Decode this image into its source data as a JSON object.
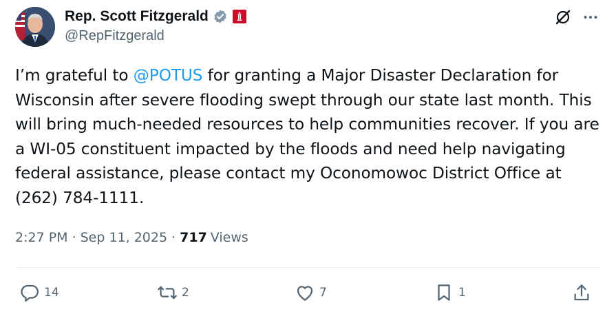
{
  "author": {
    "display_name": "Rep. Scott Fitzgerald",
    "handle": "@RepFitzgerald",
    "verified_color": "#829aab",
    "affiliation_color": "#c8102e"
  },
  "tweet": {
    "pre_mention": "I’m grateful to ",
    "mention": "@POTUS",
    "post_mention": " for granting a Major Disaster Declaration for Wisconsin after severe flooding swept through our state last month. This will bring much-needed resources to help communities recover. If you are a WI-05 constituent impacted by the floods and need help navigating federal assistance, please contact my Oconomowoc District Office at (262) 784-1111."
  },
  "meta": {
    "time": "2:27 PM",
    "date": "Sep 11, 2025",
    "views_count": "717",
    "views_label": "Views"
  },
  "actions": {
    "replies": "14",
    "reposts": "2",
    "likes": "7",
    "bookmarks": "1"
  },
  "colors": {
    "text": "#0f1419",
    "secondary": "#536471",
    "accent": "#1d9bf0"
  },
  "icons": [
    "grok-icon",
    "more-icon",
    "reply-icon",
    "repost-icon",
    "like-icon",
    "bookmark-icon",
    "share-icon"
  ]
}
